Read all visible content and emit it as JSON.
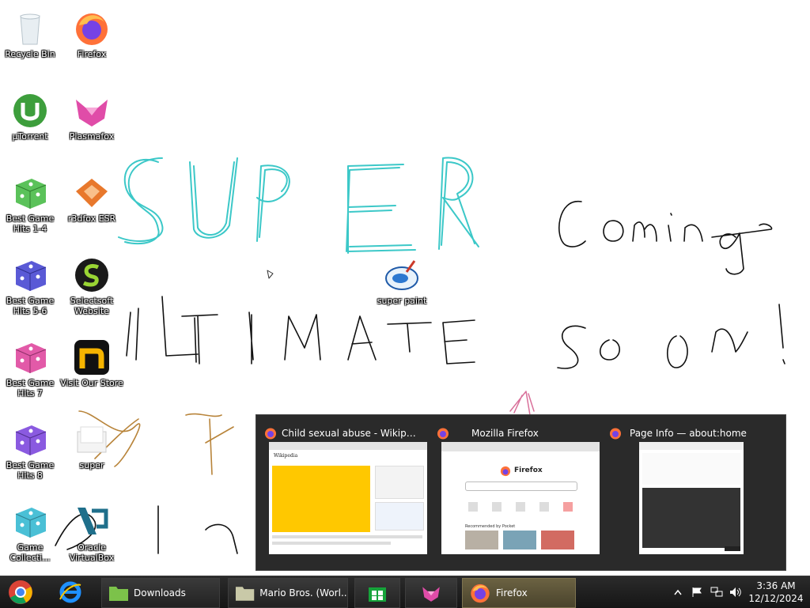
{
  "desktop": {
    "icons": [
      {
        "label": "Recycle Bin",
        "icon": "recycle-bin-icon"
      },
      {
        "label": "Firefox",
        "icon": "firefox-icon"
      },
      {
        "label": "µTorrent",
        "icon": "utorrent-icon"
      },
      {
        "label": "Plasmafox",
        "icon": "plasmafox-icon"
      },
      {
        "label": "Best Game Hits 1-4",
        "icon": "dice-green-icon"
      },
      {
        "label": "r3dfox ESR",
        "icon": "r3dfox-icon"
      },
      {
        "label": "Best Game Hits 5-6",
        "icon": "dice-purple-icon"
      },
      {
        "label": "Selectsoft Website",
        "icon": "selectsoft-icon"
      },
      {
        "label": "Best Game Hits 7",
        "icon": "dice-pink-icon"
      },
      {
        "label": "Visit Our Store",
        "icon": "store-n-icon"
      },
      {
        "label": "Best Game Hits 8",
        "icon": "dice-violet-icon"
      },
      {
        "label": "super",
        "icon": "folder-icon"
      },
      {
        "label": "Game Collecti...",
        "icon": "dice-cyan-icon"
      },
      {
        "label": "Oracle VirtualBox",
        "icon": "virtualbox-icon"
      },
      {
        "label": "super paint",
        "icon": "paint-icon"
      }
    ],
    "drawing": {
      "colors": {
        "cyan": "#3cc8c8",
        "black": "#111111",
        "brown": "#b8843a",
        "pink": "#d9709a"
      }
    }
  },
  "preview": {
    "windows": [
      {
        "title": "Child sexual abuse - Wikipedia ...",
        "icon": "firefox-icon"
      },
      {
        "title": "Mozilla Firefox",
        "icon": "firefox-icon"
      },
      {
        "title": "Page Info — about:home",
        "icon": "firefox-icon"
      }
    ],
    "thumb_newtab": {
      "brand": "Firefox",
      "section": "Recommended by Pocket"
    },
    "thumb_wiki": {
      "brand": "Wikipedia"
    }
  },
  "taskbar": {
    "apps": [
      {
        "label": "Downloads",
        "icon": "folder-green-icon"
      },
      {
        "label": "Mario Bros. (Worl...",
        "icon": "folder-icon"
      },
      {
        "label": "",
        "icon": "store-icon"
      },
      {
        "label": "",
        "icon": "plasmafox-icon"
      },
      {
        "label": "Firefox",
        "icon": "firefox-icon"
      }
    ],
    "clock": {
      "time": "3:36 AM",
      "date": "12/12/2024"
    },
    "tray_icons": [
      "chevron-up-icon",
      "flag-icon",
      "network-icon",
      "volume-icon"
    ]
  }
}
